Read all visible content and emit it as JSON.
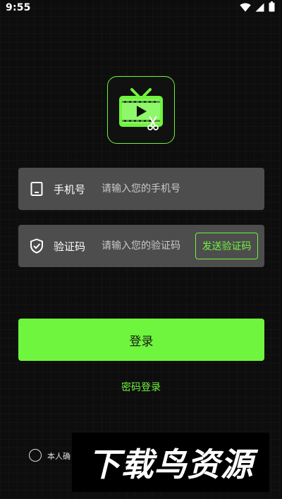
{
  "status_bar": {
    "time": "9:55",
    "icons": [
      "wifi-icon",
      "cellular-icon",
      "battery-icon"
    ]
  },
  "logo": {
    "icon": "video-edit-tv-icon",
    "accent_color": "#6ff53d"
  },
  "phone_field": {
    "icon": "phone-icon",
    "label": "手机号",
    "placeholder": "请输入您的手机号",
    "value": ""
  },
  "code_field": {
    "icon": "shield-check-icon",
    "label": "验证码",
    "placeholder": "请输入您的验证码",
    "value": "",
    "send_label": "发送验证码"
  },
  "login_button": {
    "label": "登录"
  },
  "password_login": {
    "label": "密码登录"
  },
  "agreement": {
    "checked": false,
    "text": "本人确"
  },
  "watermark": {
    "text": "下载鸟资源"
  },
  "colors": {
    "accent": "#6ff53d",
    "field_bg": "#4d4d4d",
    "background": "#0d0d0d"
  }
}
